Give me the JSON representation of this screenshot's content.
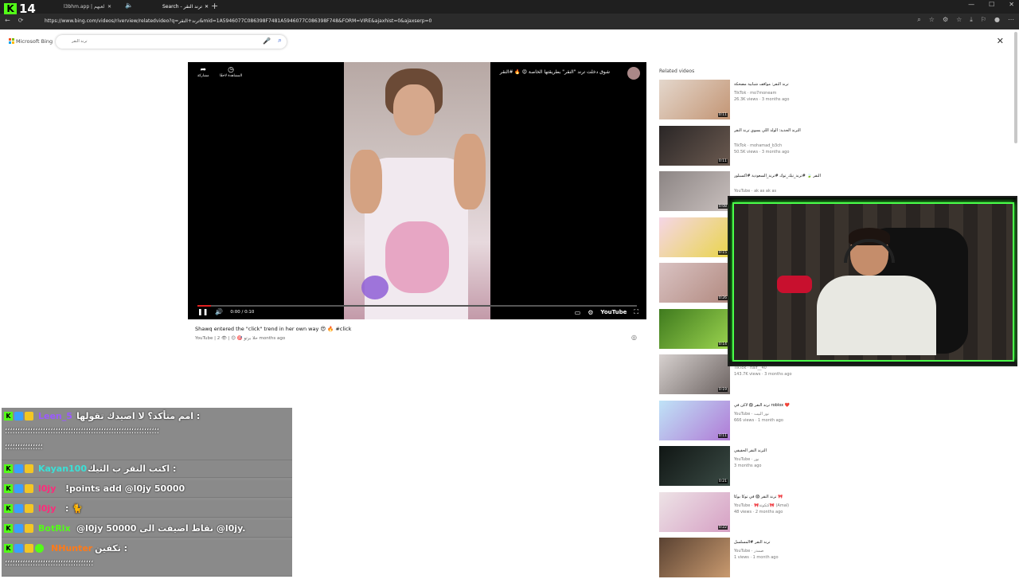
{
  "overlay": {
    "badge_k": "K",
    "badge_number": "14"
  },
  "browser": {
    "tabs": [
      {
        "title": "l3bhm.app | لعبهم",
        "close": "✕"
      },
      {
        "title": "Search - ترند النقر",
        "close": "✕"
      }
    ],
    "new_tab": "+",
    "audio_icon": "🔈",
    "window_controls": [
      "—",
      "☐",
      "✕"
    ],
    "nav": [
      "←",
      "⟳"
    ],
    "url": "https://www.bing.com/videos/riverview/relatedvideo?q=ترند+النقر&mid=1A5946077C086398F7481A5946077C086398F748&FORM=VIRE&ajaxhist=0&ajaxserp=0",
    "tools": [
      "⌕",
      "☆",
      "⚙",
      "☆",
      "⤓",
      "⚐",
      "●",
      "⋯"
    ]
  },
  "bing": {
    "brand": "Microsoft Bing",
    "query": "ترند النقر",
    "mic": "🎤",
    "search_icon": "⌕",
    "close": "✕"
  },
  "player": {
    "channel_title": "شوق دخلت ترند \"النقر\" بطريقتها الخاصة 😍 🔥 #النقر",
    "share": "مشاركة",
    "watch_later": "المشاهدة لاحقًا",
    "time": "0:00 / 0:10",
    "progress": 0.03,
    "play": "❚❚",
    "volume": "🔊",
    "cc": "▭",
    "settings": "⚙",
    "yt": "YouTube",
    "fullscreen": "⛶"
  },
  "video": {
    "title": "Shawq entered the \"click\" trend in her own way 😍 🔥 #click",
    "meta": "YouTube  |  حلا برتو 🎯 😊  |  👁  2 months ago",
    "more": "◎"
  },
  "related": {
    "heading": "Related videos",
    "items": [
      {
        "title": "ترند النقر: مواقف شبابية مضحكة",
        "source": "TikTok · mo7moneam",
        "views": "26.3K views · 3 months ago",
        "duration": "0:11",
        "c1": "#e4d7cc",
        "c2": "#c39574"
      },
      {
        "title": "الترند الجديد: الولد اللي يسوي ترند النقر",
        "source": "TikTok · mohamad_b3ch",
        "views": "50.5K views · 3 months ago",
        "duration": "0:11",
        "c1": "#2a2626",
        "c2": "#6b5a50"
      },
      {
        "title": "ترند جديد النقر 🍃 #ترند_تيك_توك #ترند_السعودية #اكسبلور funny #funny",
        "source": "YouTube · ak as ak as",
        "views": "",
        "duration": "0:08",
        "c1": "#8c8584",
        "c2": "#c8bfbd"
      },
      {
        "title": "",
        "source": "",
        "views": "",
        "duration": "0:15",
        "c1": "#f5d6e6",
        "c2": "#e9d54a"
      },
      {
        "title": "",
        "source": "",
        "views": "",
        "duration": "0:26",
        "c1": "#d9c2c2",
        "c2": "#b28a80"
      },
      {
        "title": "",
        "source": "",
        "views": "",
        "duration": "0:14",
        "c1": "#3f7a1e",
        "c2": "#9bd44f"
      },
      {
        "title": "",
        "source": "TikTok · naif__40",
        "views": "143.7K views · 3 months ago",
        "duration": "0:19",
        "c1": "#d7d1cf",
        "c2": "#6b6260"
      },
      {
        "title": "ترند النقر 😱 لاكن في roblox ❤️",
        "source": "YouTube · نور البيت",
        "views": "666 views · 1 month ago",
        "duration": "0:11",
        "c1": "#bfe3f7",
        "c2": "#b07ad6"
      },
      {
        "title": "الترند النقر الحقيقي",
        "source": "YouTube · نور",
        "views": "3 months ago",
        "duration": "0:21",
        "c1": "#101614",
        "c2": "#3a4a44"
      },
      {
        "title": "ترند النقر 😱 في توكا بوكا 🎀",
        "source": "YouTube · 🎀كتكوتة🎀 (Amal)",
        "views": "48 views · 2 months ago",
        "duration": "0:22",
        "c1": "#ede3e6",
        "c2": "#d6a0c4"
      },
      {
        "title": "ترند النقر #المسلسل",
        "source": "YouTube · صمدر",
        "views": "1 views · 1 month ago",
        "duration": "",
        "c1": "#5a4232",
        "c2": "#c99a6f"
      }
    ]
  },
  "chat": {
    "messages": [
      {
        "user": "Leen_5",
        "ucolor": "#9b59ff",
        "text": "امم متأكد؟ لا اصيدك تقولها :",
        "text2": "؛؛؛؛؛؛؛؛؛؛؛؛؛؛؛؛؛؛؛؛؛؛؛؛؛؛؛؛؛؛؛؛؛؛؛؛؛؛؛؛؛؛؛؛؛؛؛؛؛؛؛؛؛؛؛؛؛؛؛؛؛",
        "text3": "؛؛؛؛؛؛؛؛؛؛؛؛؛؛؛"
      },
      {
        "user": "Kayan100",
        "ucolor": "#3ae0d6",
        "text": "اكتب النقر ب التيك :"
      },
      {
        "user": "l0jy",
        "ucolor": "#ff2a7a",
        "text": "!points add @l0jy 50000"
      },
      {
        "user": "l0jy",
        "ucolor": "#ff2a7a",
        "text": ": 🐈"
      },
      {
        "user": "BotRix",
        "ucolor": "#53fc18",
        "text": "@l0jy 50000 نقاط اضيفت الى @l0jy."
      },
      {
        "user": "NHunter",
        "ucolor": "#ff7a18",
        "text": "تكفين :",
        "text2": "؛؛؛؛؛؛؛؛؛؛؛؛؛؛؛؛؛؛؛؛؛؛؛؛؛؛؛؛؛؛؛؛؛؛؛"
      }
    ]
  }
}
